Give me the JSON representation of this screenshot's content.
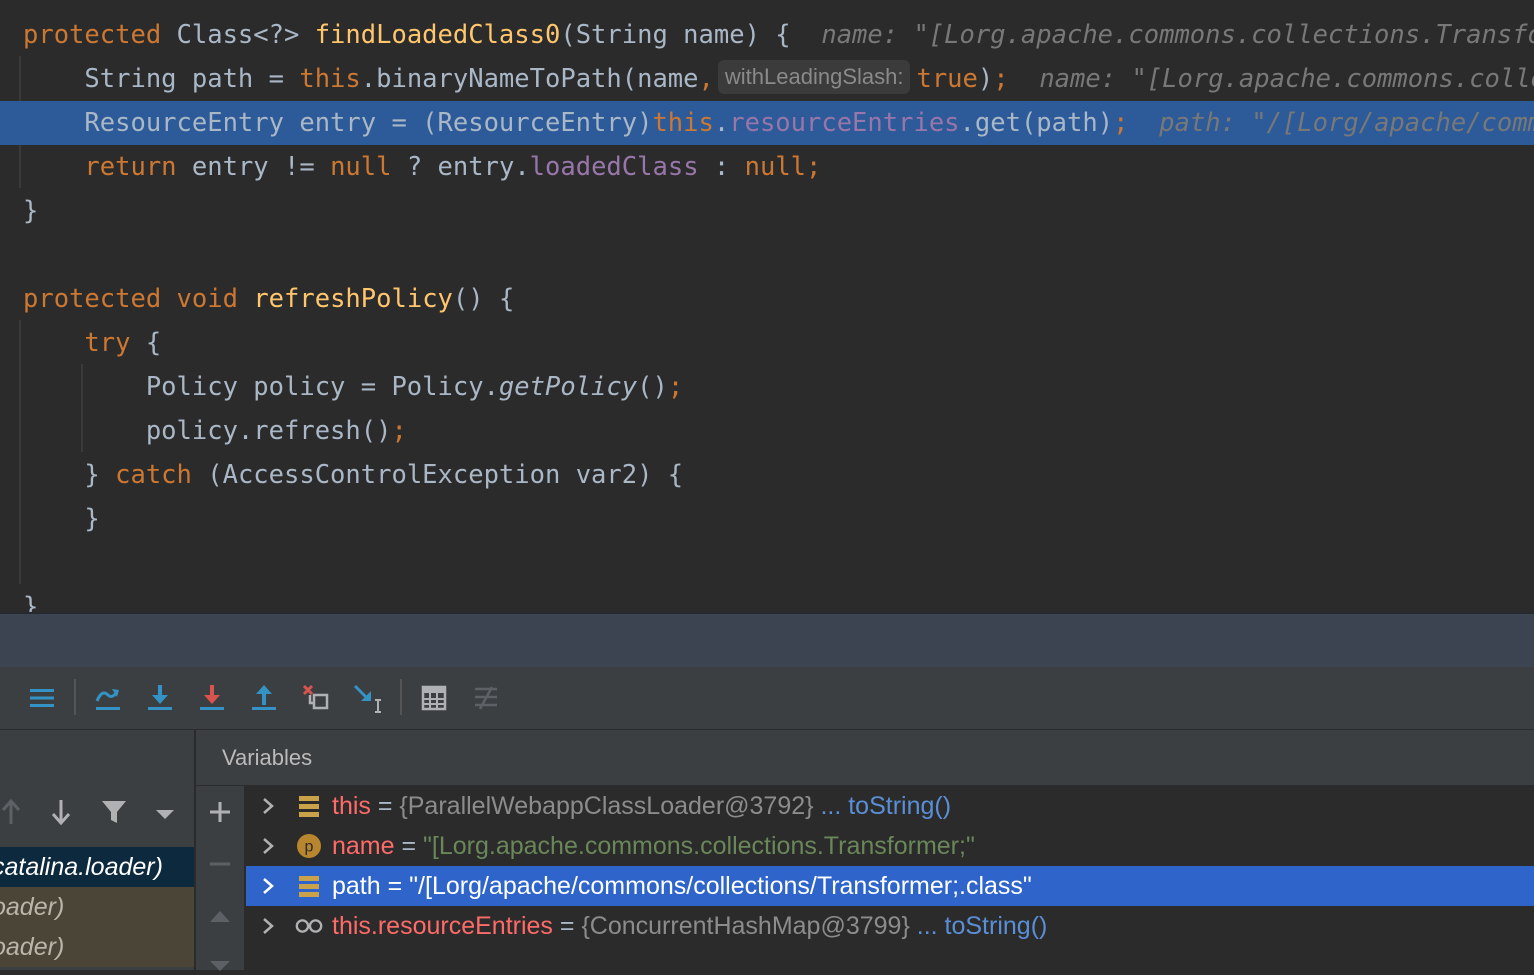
{
  "editor": {
    "lines": [
      {
        "id": "l1",
        "segs": [
          {
            "t": "protected",
            "c": "kw"
          },
          {
            "t": " Class<?> "
          },
          {
            "t": "findLoadedClass0",
            "c": "fn"
          },
          {
            "t": "(String name) {  "
          },
          {
            "t": "name: \"[Lorg.apache.commons.collections.Transformer;\"",
            "c": "hint"
          }
        ]
      },
      {
        "id": "l2",
        "segs": [
          {
            "t": "    String path = "
          },
          {
            "t": "this",
            "c": "kw"
          },
          {
            "t": ".binaryNameToPath(name"
          },
          {
            "t": ",",
            "c": "kw"
          },
          {
            "t": "withLeadingSlash:",
            "c": "inlay"
          },
          {
            "t": "true",
            "c": "kw"
          },
          {
            "t": ")"
          },
          {
            "t": ";",
            "c": "kw"
          },
          {
            "t": "  "
          },
          {
            "t": "name: \"[Lorg.apache.commons.collections.Transformer;\"",
            "c": "hint"
          }
        ]
      },
      {
        "id": "l3",
        "hl": true,
        "segs": [
          {
            "t": "    ResourceEntry entry = (ResourceEntry)"
          },
          {
            "t": "this",
            "c": "kw"
          },
          {
            "t": "."
          },
          {
            "t": "resourceEntries",
            "c": "fld"
          },
          {
            "t": ".get(path)"
          },
          {
            "t": ";",
            "c": "kw"
          },
          {
            "t": "  "
          },
          {
            "t": "path: \"/[Lorg/apache/commons/collections/Transformer;.class\"",
            "c": "hint"
          }
        ]
      },
      {
        "id": "l4",
        "segs": [
          {
            "t": "    "
          },
          {
            "t": "return",
            "c": "kw"
          },
          {
            "t": " entry != "
          },
          {
            "t": "null",
            "c": "kw"
          },
          {
            "t": " ? entry."
          },
          {
            "t": "loadedClass",
            "c": "fld"
          },
          {
            "t": " : "
          },
          {
            "t": "null",
            "c": "kw"
          },
          {
            "t": ";",
            "c": "kw"
          }
        ]
      },
      {
        "id": "l5",
        "segs": [
          {
            "t": "}"
          }
        ]
      },
      {
        "id": "l6",
        "segs": [
          {
            "t": ""
          }
        ]
      },
      {
        "id": "l7",
        "segs": [
          {
            "t": "protected",
            "c": "kw"
          },
          {
            "t": " "
          },
          {
            "t": "void",
            "c": "kw"
          },
          {
            "t": " "
          },
          {
            "t": "refreshPolicy",
            "c": "fn"
          },
          {
            "t": "() {"
          }
        ]
      },
      {
        "id": "l8",
        "segs": [
          {
            "t": "    "
          },
          {
            "t": "try",
            "c": "kw"
          },
          {
            "t": " {"
          }
        ]
      },
      {
        "id": "l9",
        "segs": [
          {
            "t": "        Policy policy = Policy."
          },
          {
            "t": "getPolicy",
            "c": "it"
          },
          {
            "t": "()"
          },
          {
            "t": ";",
            "c": "kw"
          }
        ]
      },
      {
        "id": "l10",
        "segs": [
          {
            "t": "        policy.refresh()"
          },
          {
            "t": ";",
            "c": "kw"
          }
        ]
      },
      {
        "id": "l11",
        "segs": [
          {
            "t": "    } "
          },
          {
            "t": "catch",
            "c": "kw"
          },
          {
            "t": " (AccessControlException var2) {"
          }
        ]
      },
      {
        "id": "l12",
        "segs": [
          {
            "t": "    }"
          }
        ]
      },
      {
        "id": "l13",
        "segs": [
          {
            "t": ""
          }
        ]
      },
      {
        "id": "l14",
        "segs": [
          {
            "t": "}"
          }
        ]
      }
    ]
  },
  "toolbar": {
    "buttons": [
      {
        "name": "show-frames-icon",
        "icon": "menu"
      },
      {
        "name": "step-over-icon",
        "icon": "step-over"
      },
      {
        "name": "step-into-icon",
        "icon": "step-into"
      },
      {
        "name": "force-step-into-icon",
        "icon": "force-step-into"
      },
      {
        "name": "step-out-icon",
        "icon": "step-out"
      },
      {
        "name": "drop-frame-icon",
        "icon": "drop-frame"
      },
      {
        "name": "run-to-cursor-icon",
        "icon": "run-to-cursor"
      },
      {
        "name": "evaluate-expression-icon",
        "icon": "calculator"
      },
      {
        "name": "trace-stream-icon",
        "icon": "trace"
      }
    ]
  },
  "frames": {
    "items": [
      {
        "label": "catalina.loader)",
        "selected": true
      },
      {
        "label": "oader)",
        "selected": false
      },
      {
        "label": "oader)",
        "selected": false
      }
    ]
  },
  "variables": {
    "title": "Variables",
    "rows": [
      {
        "icon": "field",
        "name": "this",
        "eq": " = ",
        "value": "{ParallelWebappClassLoader@3792}",
        "value_kind": "gray",
        "link": "... toString()",
        "selected": false
      },
      {
        "icon": "param",
        "name": "name",
        "eq": " = ",
        "value": "\"[Lorg.apache.commons.collections.Transformer;\"",
        "value_kind": "str",
        "link": "",
        "selected": false
      },
      {
        "icon": "field",
        "name": "path",
        "eq": " = ",
        "value": "\"/[Lorg/apache/commons/collections/Transformer;.class\"",
        "value_kind": "str",
        "link": "",
        "selected": true
      },
      {
        "icon": "watch",
        "name": "this.resourceEntries",
        "eq": " = ",
        "value": "{ConcurrentHashMap@3799}",
        "value_kind": "gray",
        "link": "... toString()",
        "selected": false
      }
    ]
  },
  "colors": {
    "editor_bg": "#2b2b2b",
    "keyword": "#cc7832",
    "function": "#ffc66d",
    "field": "#9876aa",
    "execution_line": "#2d5a98",
    "selection": "#2f65ca",
    "string": "#6a8759",
    "var_name": "#ff6b68"
  }
}
